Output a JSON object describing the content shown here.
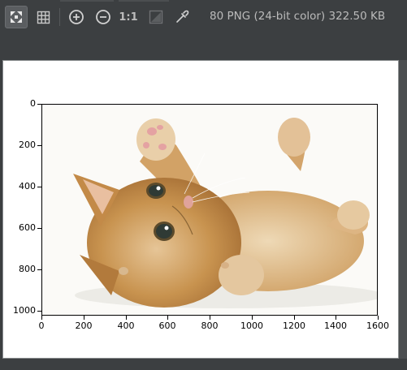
{
  "toolbar": {
    "buttons": [
      {
        "name": "fit-to-window",
        "icon": "fit-to-window-icon",
        "active": true
      },
      {
        "name": "grid",
        "icon": "grid-icon"
      },
      {
        "name": "zoom-in",
        "icon": "zoom-in-icon"
      },
      {
        "name": "zoom-out",
        "icon": "zoom-out-icon"
      },
      {
        "name": "actual-size",
        "label": "1:1"
      },
      {
        "name": "background",
        "icon": "background-icon",
        "disabled": true
      },
      {
        "name": "color-picker",
        "icon": "eyedropper-icon"
      }
    ],
    "info_text": "80 PNG (24-bit color) 322.50 KB"
  },
  "image": {
    "subject": "kitten",
    "description_colors": {
      "fur": "#c89456",
      "background": "#fbfaf7"
    }
  },
  "chart_data": {
    "type": "image",
    "xlim": [
      0,
      1600
    ],
    "ylim": [
      1024,
      0
    ],
    "xticks": [
      0,
      200,
      400,
      600,
      800,
      1000,
      1200,
      1400,
      1600
    ],
    "yticks": [
      0,
      200,
      400,
      600,
      800,
      1000
    ],
    "xtick_labels": [
      "0",
      "200",
      "400",
      "600",
      "800",
      "1000",
      "1200",
      "1400",
      "1600"
    ],
    "ytick_labels": [
      "0",
      "200",
      "400",
      "600",
      "800",
      "1000"
    ]
  },
  "colors": {
    "toolbar_bg": "#3c3f41",
    "text": "#bbbbbb",
    "plot_border": "#000000"
  }
}
